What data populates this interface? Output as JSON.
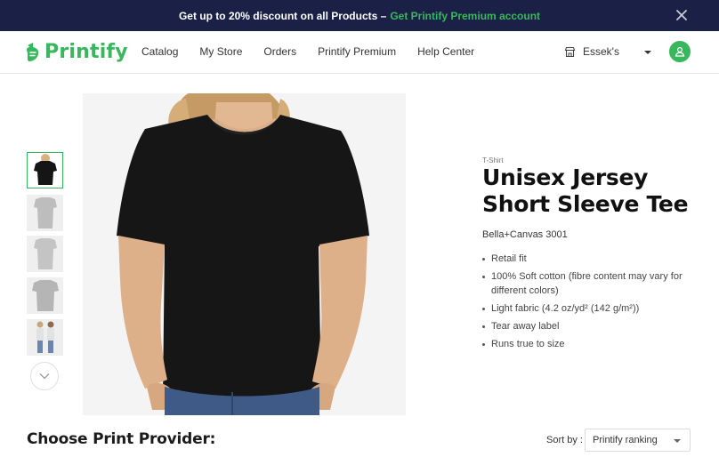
{
  "promo": {
    "text": "Get up to 20% discount on all Products –",
    "link": "Get Printify Premium account"
  },
  "header": {
    "logo_text": "Printify",
    "nav": [
      "Catalog",
      "My Store",
      "Orders",
      "Printify Premium",
      "Help Center"
    ],
    "store_name": "Essek's"
  },
  "product": {
    "category": "T-Shirt",
    "title": "Unisex Jersey Short Sleeve Tee",
    "brand": "Bella+Canvas 3001",
    "features": [
      "Retail fit",
      "100% Soft cotton (fibre content may vary for different colors)",
      "Light fabric (4.2 oz/yd² (142 g/m²))",
      "Tear away label",
      "Runs true to size"
    ]
  },
  "providers": {
    "heading": "Choose Print Provider:",
    "sort_label": "Sort by :",
    "sort_value": "Printify ranking"
  },
  "colors": {
    "brand_green": "#39b75d",
    "banner_navy": "#1b2146"
  }
}
